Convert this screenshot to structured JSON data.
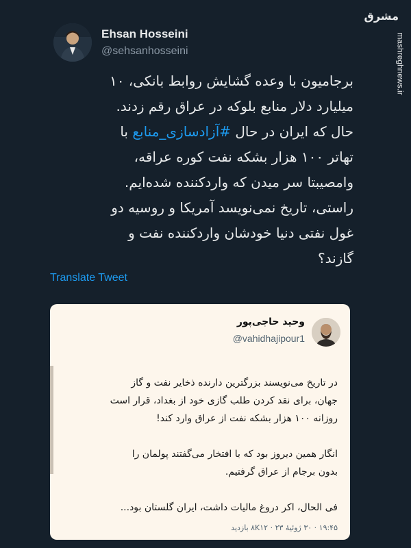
{
  "author": {
    "name": "Ehsan Hosseini",
    "handle": "@sehsanhosseini"
  },
  "watermark": {
    "logo": "مشرق",
    "url": "mashreghnews.ir"
  },
  "tweet": {
    "line1": "برجامیون با وعده گشایش روابط بانکی، ۱۰",
    "line2": "میلیارد دلار منابع بلوکه در عراق رقم زدند.",
    "line3_before": "حال که ایران در حال ",
    "hashtag": "#آزادسازی_منابع",
    "line3_after": " با",
    "line4": "تهاتر ۱۰۰ هزار بشکه نفت کوره عراقه،",
    "line5": "وامصیبتا سر میدن که واردکننده شده‌ایم.",
    "line6": "راستی، تاریخ نمی‌نویسد آمریکا و روسیه دو",
    "line7": "غول نفتی دنیا خودشان واردکننده نفت و",
    "line8": "گازند؟"
  },
  "translate_label": "Translate Tweet",
  "quote": {
    "name": "وحید حاجی‌پور",
    "handle": "@vahidhajipour1",
    "lines": [
      "در تاریخ می‌نویسند بزرگترین دارنده ذخایر نفت و گاز",
      "جهان، برای نقد کردن طلب گازی خود از بغداد، قرار است",
      "روزانه ۱۰۰ هزار بشکه نفت از عراق وارد کند!",
      "انگار همین دیروز بود که با افتخار می‌گفتند پولمان را",
      "بدون برجام از عراق گرفتیم.",
      "فی الحال، اکر دروغ مالیات داشت، ایران گلستان بود..."
    ],
    "meta": "۱۹:۴۵ · ۳۰ ژوئیهٔ ۲۳ · ۸K۱۲ بازدید"
  }
}
